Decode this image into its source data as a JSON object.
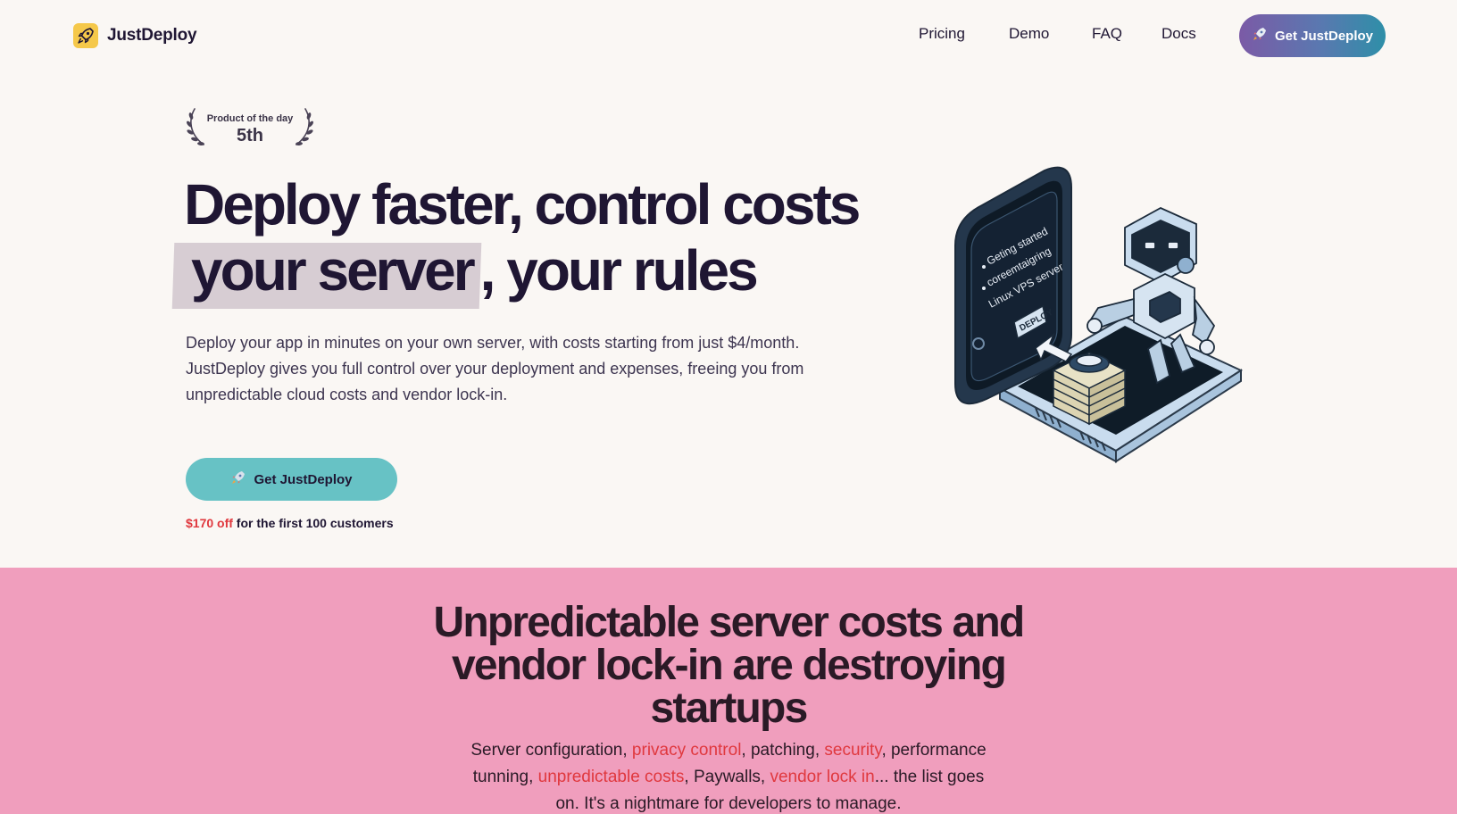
{
  "brand": {
    "name": "JustDeploy",
    "logo_icon": "rocket-icon"
  },
  "nav": {
    "links": [
      "Pricing",
      "Demo",
      "FAQ",
      "Docs"
    ],
    "cta_label": "Get JustDeploy"
  },
  "award": {
    "label": "Product of the day",
    "rank": "5th"
  },
  "hero": {
    "title_line1": "Deploy faster, control costs",
    "title_highlight": "your server",
    "title_line2_rest": ", your rules",
    "description": "Deploy your app in minutes on your own server, with costs starting from just $4/month. JustDeploy gives you full control over your deployment and expenses, freeing you from unpredictable cloud costs and vendor lock-in.",
    "cta_label": "Get JustDeploy",
    "offer_highlight": "$170 off",
    "offer_rest": " for the first 100 customers",
    "illustration_text": {
      "line1": "Geting started",
      "line2": "coreemtaigring",
      "line3": "Linux VPS server",
      "button": "DEPLOY"
    }
  },
  "problem": {
    "title": "Unpredictable server costs and vendor lock-in are destroying startups",
    "text": {
      "t1": "Server configuration, ",
      "h1": "privacy control",
      "t2": ", patching, ",
      "h2": "security",
      "t3": ", performance tunning, ",
      "h3": "unpredictable costs",
      "t4": ", Paywalls, ",
      "h4": "vendor lock in",
      "t5": "... the list goes on. It's a nightmare for developers to manage."
    }
  },
  "colors": {
    "background": "#faf7f4",
    "text": "#1f1633",
    "teal_button": "#67c2c5",
    "pink_section": "#f09ebd",
    "accent_red": "#e0383e",
    "highlight": "#d7cdd3",
    "logo_yellow": "#f5c84a"
  }
}
